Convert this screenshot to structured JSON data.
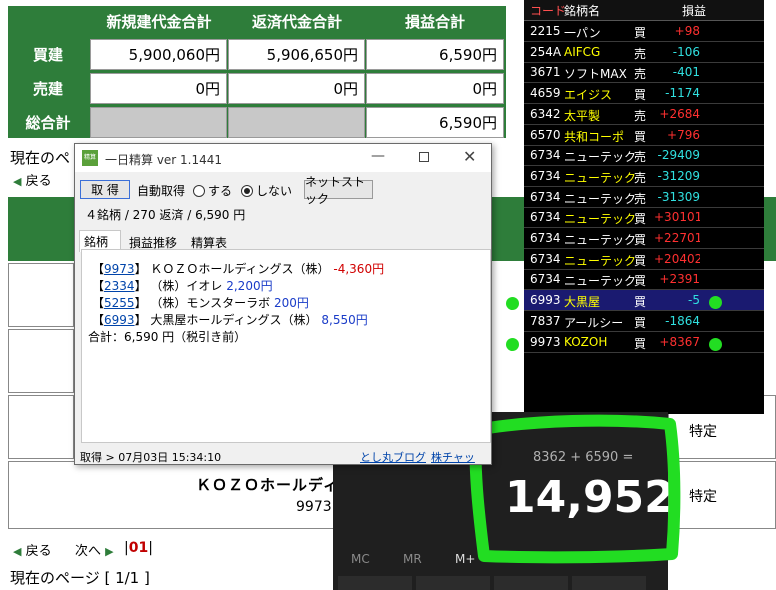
{
  "summary": {
    "headers": [
      "新規建代金合計",
      "返済代金合計",
      "損益合計"
    ],
    "rows": [
      {
        "label": "買建",
        "values": [
          "5,900,060円",
          "5,906,650円",
          "6,590円"
        ]
      },
      {
        "label": "売建",
        "values": [
          "0円",
          "0円",
          "0円"
        ]
      },
      {
        "label": "総合計",
        "values": [
          "",
          "",
          "6,590円"
        ]
      }
    ]
  },
  "page_nav": {
    "current_page_top": "現在のペ",
    "back": "戻る",
    "next": "次へ",
    "page_link": "01",
    "current_page_bottom": "現在のページ [ 1/1 ]"
  },
  "bg_rows": {
    "stock_name": "ＫＯＺＯホールディ",
    "stock_code": "9973",
    "type1": "特定",
    "type2": "特定"
  },
  "stock_list": {
    "headers": [
      "コード",
      "銘柄名",
      "",
      "損益"
    ],
    "rows": [
      {
        "code": "2215",
        "name": "一パン",
        "side": "買",
        "pl": "+98",
        "name_color": "#ffffff",
        "pl_color": "#ff3030"
      },
      {
        "code": "254A",
        "name": "AIFCG",
        "side": "売",
        "pl": "-106",
        "name_color": "#ffff00",
        "pl_color": "#30e0e0"
      },
      {
        "code": "3671",
        "name": "ソフトMAX",
        "side": "売",
        "pl": "-401",
        "name_color": "#ffffff",
        "pl_color": "#30e0e0"
      },
      {
        "code": "4659",
        "name": "エイジス",
        "side": "買",
        "pl": "-1174",
        "name_color": "#ffff00",
        "pl_color": "#30e0e0"
      },
      {
        "code": "6342",
        "name": "太平製",
        "side": "売",
        "pl": "+2684",
        "name_color": "#ffff00",
        "pl_color": "#ff3030"
      },
      {
        "code": "6570",
        "name": "共和コーポ",
        "side": "買",
        "pl": "+796",
        "name_color": "#ffff00",
        "pl_color": "#ff3030"
      },
      {
        "code": "6734",
        "name": "ニューテック",
        "side": "売",
        "pl": "-29409",
        "name_color": "#ffffff",
        "pl_color": "#30e0e0"
      },
      {
        "code": "6734",
        "name": "ニューテック",
        "side": "売",
        "pl": "-31209",
        "name_color": "#ffff00",
        "pl_color": "#30e0e0"
      },
      {
        "code": "6734",
        "name": "ニューテック",
        "side": "売",
        "pl": "-31309",
        "name_color": "#ffffff",
        "pl_color": "#30e0e0"
      },
      {
        "code": "6734",
        "name": "ニューテック",
        "side": "買",
        "pl": "+30101",
        "name_color": "#ffff00",
        "pl_color": "#ff3030"
      },
      {
        "code": "6734",
        "name": "ニューテック",
        "side": "買",
        "pl": "+22701",
        "name_color": "#ffffff",
        "pl_color": "#ff3030"
      },
      {
        "code": "6734",
        "name": "ニューテック",
        "side": "買",
        "pl": "+20402",
        "name_color": "#ffff00",
        "pl_color": "#ff3030"
      },
      {
        "code": "6734",
        "name": "ニューテック",
        "side": "買",
        "pl": "+2391",
        "name_color": "#ffffff",
        "pl_color": "#ff3030"
      },
      {
        "code": "6993",
        "name": "大黒屋",
        "side": "買",
        "pl": "-5",
        "name_color": "#ffff00",
        "pl_color": "#30e0e0"
      },
      {
        "code": "7837",
        "name": "アールシー",
        "side": "買",
        "pl": "-1864",
        "name_color": "#ffffff",
        "pl_color": "#30e0e0"
      },
      {
        "code": "9973",
        "name": "KOZOH",
        "side": "買",
        "pl": "+8367",
        "name_color": "#ffff00",
        "pl_color": "#ff3030"
      }
    ]
  },
  "dialog": {
    "title": "一日精算 ver 1.1441",
    "icon_text": "精算",
    "fetch_button": "取 得",
    "auto_fetch_label": "自動取得",
    "radio_on": "する",
    "radio_off": "しない",
    "net_stock_button": "ネットストック",
    "summary_line": "４銘柄 / 270 返済 / 6,590 円",
    "tabs": [
      "銘柄別",
      "損益推移",
      "精算表"
    ],
    "entries": [
      {
        "code": "9973",
        "name": "ＫＯＺＯホールディングス（株）",
        "pl": "-4,360円"
      },
      {
        "code": "2334",
        "name": "（株）イオレ",
        "pl": "2,200円"
      },
      {
        "code": "5255",
        "name": "（株）モンスターラボ",
        "pl": "200円"
      },
      {
        "code": "6993",
        "name": "大黒屋ホールディングス（株）",
        "pl": "8,550円"
      }
    ],
    "total_line": "合計：6,590 円（税引き前）",
    "status_text": "取得 > 07月03日 15:34:10",
    "blog_link": "とし丸ブログ",
    "chart_link": "株チャッ"
  },
  "calculator": {
    "expression": "8362 + 6590 =",
    "result": "14,952",
    "memory_keys": [
      "MC",
      "MR",
      "M+"
    ]
  },
  "colors": {
    "green_header": "#2e7d3a",
    "highlight": "#22dd22",
    "profit_red": "#ff3030",
    "loss_cyan": "#30e0e0"
  }
}
